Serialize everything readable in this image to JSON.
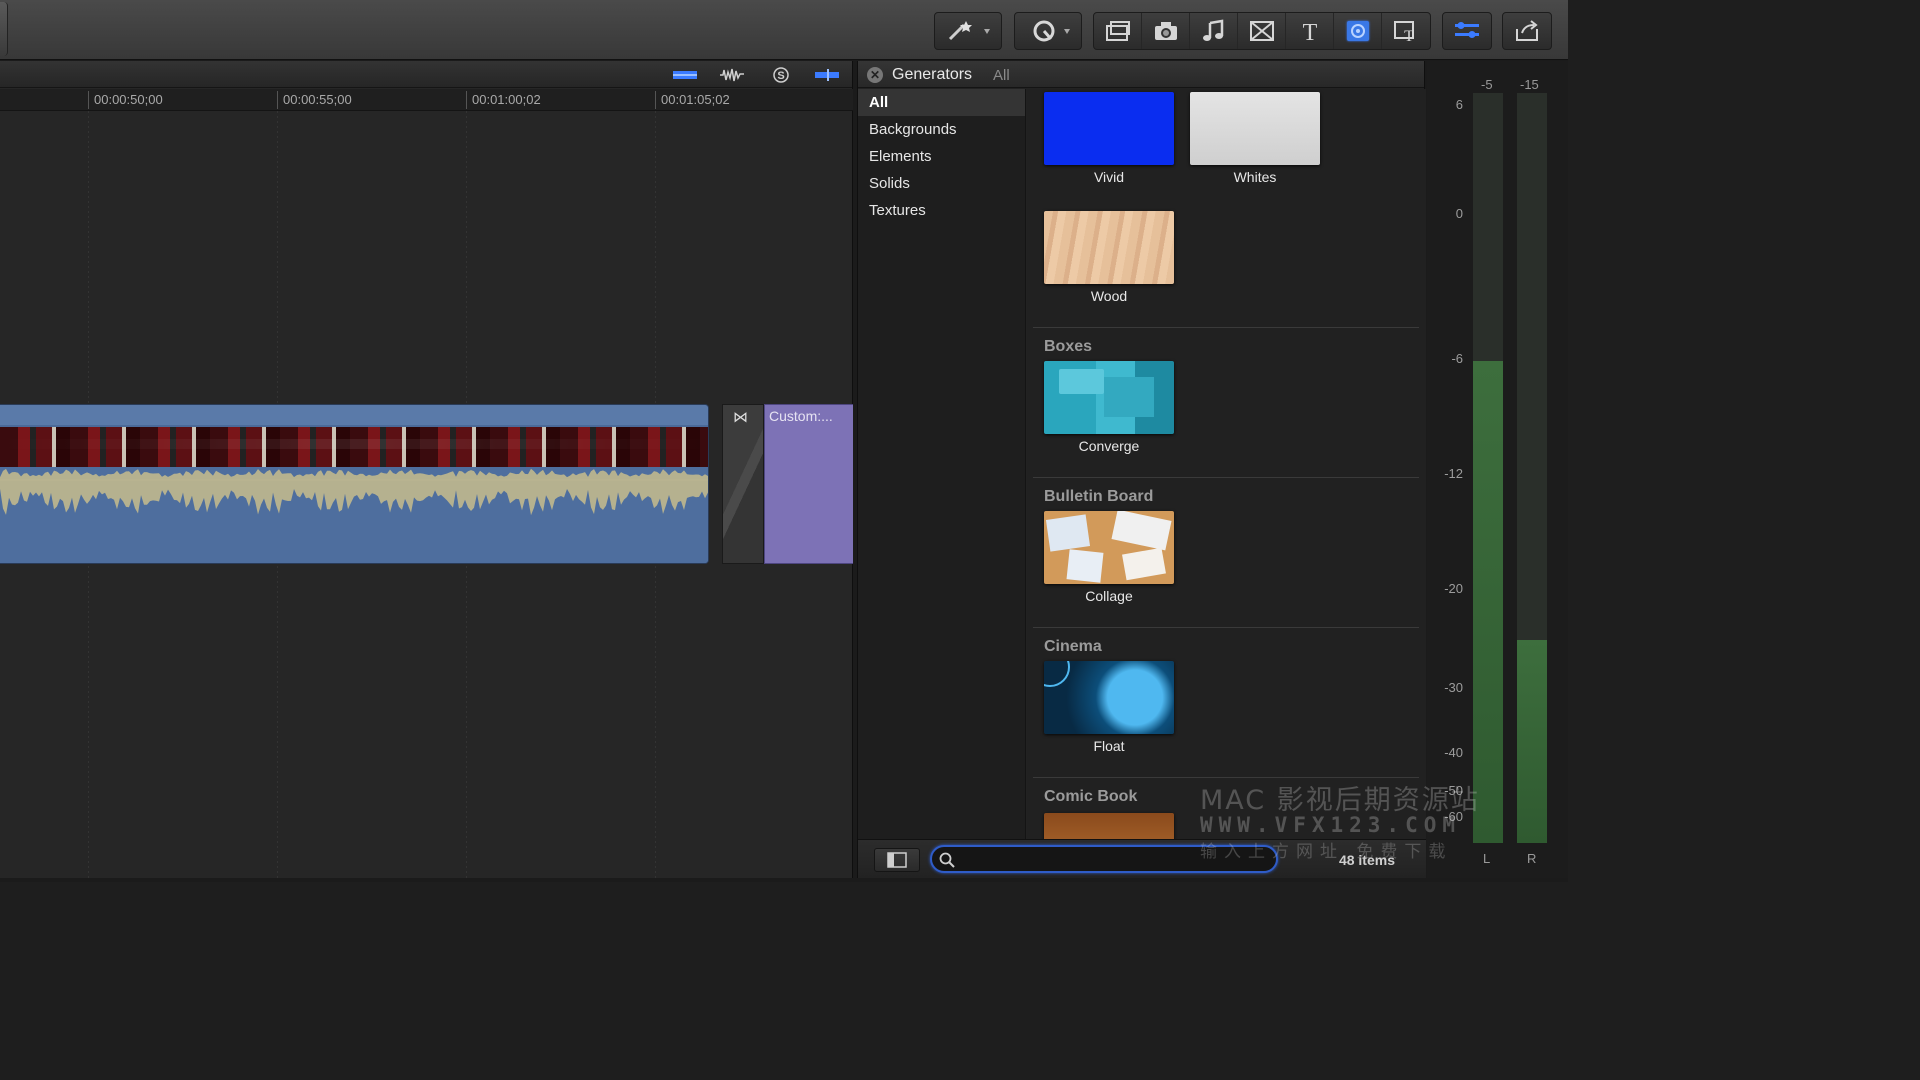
{
  "timeline": {
    "ticks": [
      "00:00:50;00",
      "00:00:55;00",
      "00:01:00;02",
      "00:01:05;02"
    ],
    "title_clip_label": "Custom:..."
  },
  "browser": {
    "title": "Generators",
    "filter": "All",
    "categories": [
      "All",
      "Backgrounds",
      "Elements",
      "Solids",
      "Textures"
    ],
    "selected_category": "All",
    "items": [
      "Vivid",
      "Whites",
      "Wood",
      "Converge",
      "Collage",
      "Float"
    ],
    "sections": [
      "Boxes",
      "Bulletin Board",
      "Cinema",
      "Comic Book"
    ],
    "search_placeholder": "",
    "count": "48 items"
  },
  "meters": {
    "top_labels": [
      "-5",
      "-15"
    ],
    "scale": [
      "6",
      "0",
      "-6",
      "-12",
      "-20",
      "-30",
      "-40",
      "-50",
      "-60"
    ],
    "channels": [
      "L",
      "R"
    ],
    "levels_db": {
      "L": -6.5,
      "R": -26
    }
  },
  "watermark": {
    "line1": "MAC 影视后期资源站",
    "line2": "WWW.VFX123.COM",
    "line3": "输入上方网址 免费下载"
  },
  "colors": {
    "accent": "#2f5cc8",
    "clip_video": "#4b6a99",
    "clip_title": "#7d72b6",
    "meter": "#3d6e3d"
  }
}
